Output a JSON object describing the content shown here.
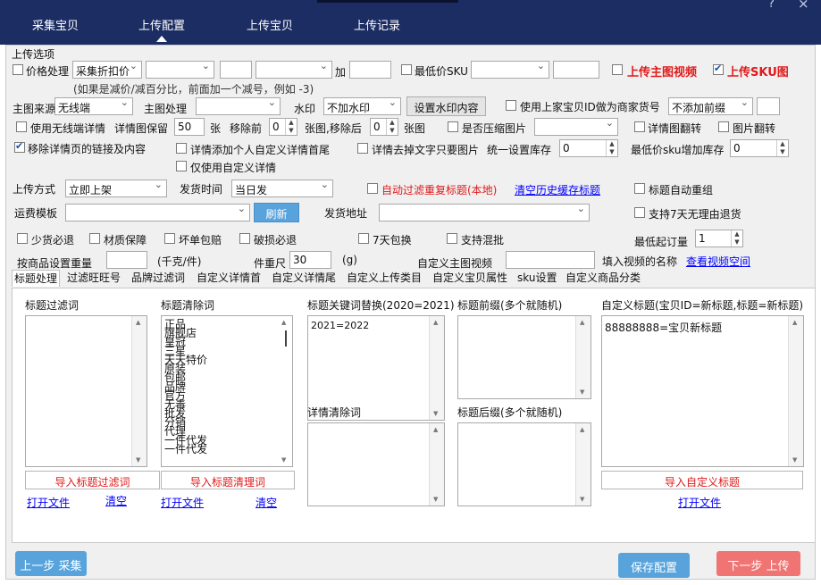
{
  "nav": {
    "tabs": [
      "采集宝贝",
      "上传配置",
      "上传宝贝",
      "上传记录"
    ],
    "window_controls": [
      "?",
      "×"
    ]
  },
  "options": {
    "section_title": "上传选项",
    "price_processing": "价格处理",
    "price_mode": "采集折扣价",
    "price_add_label": "加",
    "lowest_sku": "最低价SKU",
    "upload_main_video": "上传主图视频",
    "upload_sku_image": "上传SKU图",
    "price_hint": "(如果是减价/减百分比，前面加一个减号，例如 -3)",
    "main_img_source_label": "主图来源",
    "main_img_source": "无线端",
    "main_img_process_label": "主图处理",
    "watermark_label": "水印",
    "watermark": "不加水印",
    "watermark_button": "设置水印内容",
    "use_prev_id": "使用上家宝贝ID做为商家货号",
    "prefix_select": "不添加前缀",
    "use_wireless_detail": "使用无线端详情",
    "detail_keep_label": "详情图保留",
    "detail_keep_value": "50",
    "detail_keep_unit": "张",
    "remove_before_label": "移除前",
    "remove_before_value": "0",
    "remove_after_label": "张图,移除后",
    "remove_after_value": "0",
    "remove_after_unit": "张图",
    "compress": "是否压缩图片",
    "detail_flip": "详情图翻转",
    "image_flip": "图片翻转",
    "remove_links": "移除详情页的链接及内容",
    "add_custom_head_tail": "详情添加个人自定义详情首尾",
    "remove_text_keep_img": "详情去掉文字只要图片",
    "unified_stock_label": "统一设置库存",
    "unified_stock_value": "0",
    "lowest_sku_stock_label": "最低价sku增加库存",
    "lowest_sku_stock_value": "0",
    "only_custom_detail": "仅使用自定义详情",
    "upload_mode_label": "上传方式",
    "upload_mode": "立即上架",
    "ship_time_label": "发货时间",
    "ship_time": "当日发",
    "auto_filter_dup_title": "自动过滤重复标题(本地)",
    "clear_history": "清空历史缓存标题",
    "auto_regroup_title": "标题自动重组",
    "freight_label": "运费模板",
    "refresh_button": "刷新",
    "ship_addr_label": "发货地址",
    "support_7day": "支持7天无理由退货",
    "svc_fake": "少货必退",
    "svc_material": "材质保障",
    "svc_broken_pay": "坏单包赔",
    "svc_broken_return": "破损必退",
    "svc_7day": "7天包换",
    "svc_mix": "支持混批",
    "min_order_label": "最低起订量",
    "min_order_value": "1",
    "weight_label": "按商品设置重量",
    "weight_unit": "(千克/件)",
    "piece_weight_label": "件重尺",
    "piece_weight_value": "30",
    "piece_weight_unit": "(g)",
    "custom_video_label": "自定义主图视频",
    "fill_video_name": "填入视频的名称",
    "view_video_space": "查看视频空间"
  },
  "subtabs": [
    "标题处理",
    "过滤旺旺号",
    "品牌过滤词",
    "自定义详情首",
    "自定义详情尾",
    "自定义上传类目",
    "自定义宝贝属性",
    "sku设置",
    "自定义商品分类"
  ],
  "title_panel": {
    "filter_words_label": "标题过滤词",
    "clear_words_label": "标题清除词",
    "clear_words": [
      "正品",
      "旗舰店",
      "皇冠",
      "三星",
      "天天特价",
      "原装",
      "包邮",
      "品牌",
      "官方",
      "无毒",
      "批发",
      "分销",
      "代理",
      "一件代发",
      "一件代发"
    ],
    "keyword_replace_label": "标题关键词替换(2020=2021)",
    "keyword_replace_value": "2021=2022",
    "prefix_label": "标题前缀(多个就随机)",
    "suffix_label": "标题后缀(多个就随机)",
    "detail_clear_label": "详情清除词",
    "custom_title_label": "自定义标题(宝贝ID=新标题,标题=新标题)",
    "custom_title_value": "88888888=宝贝新标题",
    "import_filter": "导入标题过滤词",
    "import_clear": "导入标题清理词",
    "import_custom": "导入自定义标题",
    "open_file": "打开文件",
    "clear": "清空"
  },
  "footer": {
    "prev": "上一步 采集",
    "save": "保存配置",
    "next": "下一步 上传"
  },
  "colors": {
    "nav_bg": "#1c2d63",
    "btn_blue": "#58a3db",
    "btn_red": "#f07474",
    "accent_red": "#e01919"
  }
}
